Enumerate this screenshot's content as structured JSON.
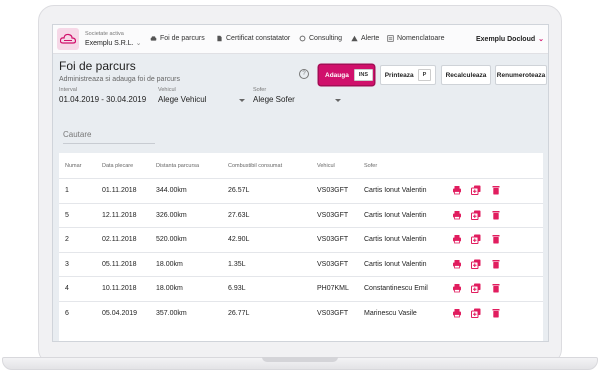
{
  "topnav": {
    "company_caption": "Societate activa",
    "company_name": "Exemplu S.R.L.",
    "items": [
      {
        "label": "Foi de parcurs",
        "icon": "car-icon"
      },
      {
        "label": "Certificat constatator",
        "icon": "document-icon"
      },
      {
        "label": "Consulting",
        "icon": "headset-icon"
      },
      {
        "label": "Alerte",
        "icon": "warning-icon"
      },
      {
        "label": "Nomenclatoare",
        "icon": "list-icon"
      }
    ],
    "user": "Exemplu Docloud"
  },
  "page": {
    "title": "Foi de parcurs",
    "subtitle": "Administreaza si adauga foi de parcurs"
  },
  "filters": {
    "interval_label": "Interval",
    "interval_value": "01.04.2019 - 30.04.2019",
    "vehicle_label": "Vehicul",
    "vehicle_value": "Alege Vehicul",
    "driver_label": "Sofer",
    "driver_value": "Alege Sofer"
  },
  "toolbar": {
    "add_label": "Adauga",
    "add_key": "INS",
    "print_label": "Printeaza",
    "print_key": "P",
    "recalc_label": "Recalculeaza",
    "renumber_label": "Renumeroteaza"
  },
  "search": {
    "placeholder": "Cautare"
  },
  "table": {
    "columns": [
      "Numar",
      "Data plecare",
      "Distanta parcursa",
      "Combustibil consumat",
      "Vehicul",
      "Sofer"
    ],
    "rows": [
      [
        "1",
        "01.11.2018",
        "344.00km",
        "26.57L",
        "VS03GFT",
        "Cartis Ionut Valentin"
      ],
      [
        "5",
        "12.11.2018",
        "326.00km",
        "27.63L",
        "VS03GFT",
        "Cartis Ionut Valentin"
      ],
      [
        "2",
        "02.11.2018",
        "520.00km",
        "42.90L",
        "VS03GFT",
        "Cartis Ionut Valentin"
      ],
      [
        "3",
        "05.11.2018",
        "18.00km",
        "1.35L",
        "VS03GFT",
        "Cartis Ionut Valentin"
      ],
      [
        "4",
        "10.11.2018",
        "18.00km",
        "6.93L",
        "PH07KML",
        "Constantinescu Emil"
      ],
      [
        "6",
        "05.04.2019",
        "357.00km",
        "26.77L",
        "VS03GFT",
        "Marinescu Vasile"
      ]
    ]
  },
  "colors": {
    "accent": "#d0106b"
  }
}
